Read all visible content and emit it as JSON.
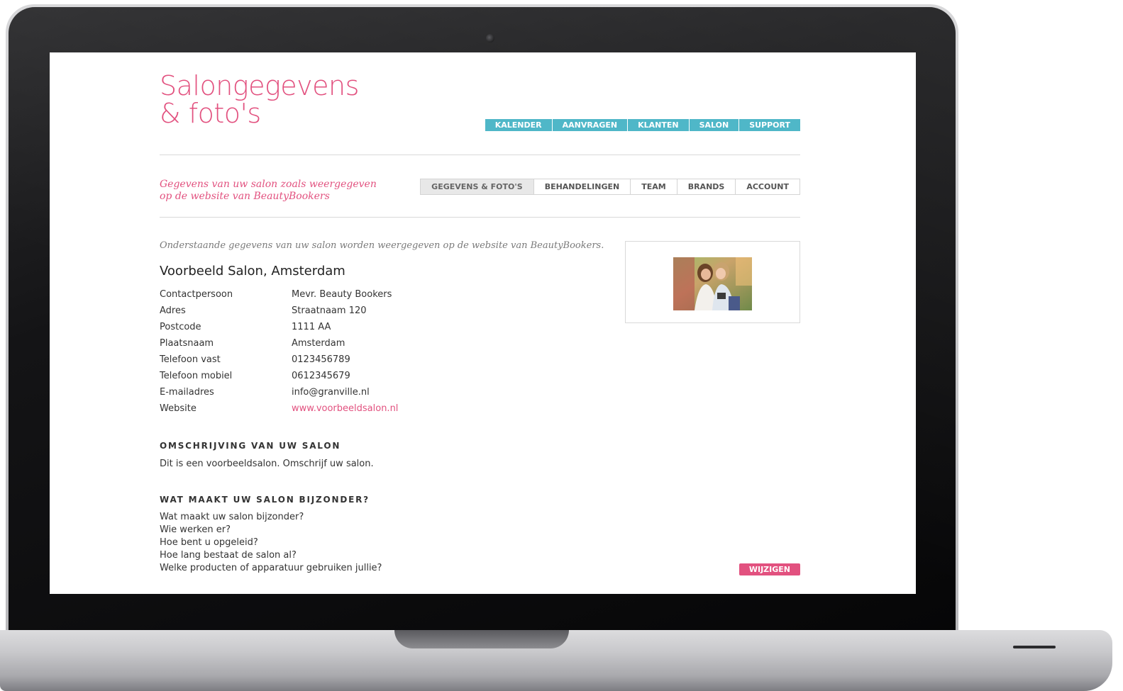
{
  "page": {
    "title_line1": "Salongegevens",
    "title_line2": "& foto's",
    "subtitle_line1": "Gegevens van uw salon zoals weergegeven",
    "subtitle_line2": "op de website van BeautyBookers"
  },
  "top_nav": [
    "KALENDER",
    "AANVRAGEN",
    "KLANTEN",
    "SALON",
    "SUPPORT"
  ],
  "sub_tabs": {
    "active": "GEGEVENS & FOTO'S",
    "items": [
      "GEGEVENS & FOTO'S",
      "BEHANDELINGEN",
      "TEAM",
      "BRANDS",
      "ACCOUNT"
    ]
  },
  "intro": "Onderstaande gegevens van uw salon worden weergegeven op de website van BeautyBookers.",
  "salon_name": "Voorbeeld Salon, Amsterdam",
  "details": [
    {
      "label": "Contactpersoon",
      "value": "Mevr. Beauty Bookers"
    },
    {
      "label": "Adres",
      "value": "Straatnaam 120"
    },
    {
      "label": "Postcode",
      "value": "1111 AA"
    },
    {
      "label": "Plaatsnaam",
      "value": "Amsterdam"
    },
    {
      "label": "Telefoon vast",
      "value": "0123456789"
    },
    {
      "label": "Telefoon mobiel",
      "value": "0612345679"
    },
    {
      "label": "E-mailadres",
      "value": "info@granville.nl"
    },
    {
      "label": "Website",
      "value": "www.voorbeeldsalon.nl"
    }
  ],
  "description": {
    "heading": "OMSCHRIJVING VAN UW SALON",
    "text": "Dit is een voorbeeldsalon. Omschrijf uw salon."
  },
  "special": {
    "heading": "WAT MAAKT UW SALON BIJZONDER?",
    "lines": [
      "Wat maakt uw salon bijzonder?",
      "Wie werken er?",
      "Hoe bent u opgeleid?",
      "Hoe lang bestaat de salon al?",
      "Welke producten of apparatuur gebruiken jullie?"
    ]
  },
  "buttons": {
    "edit": "WIJZIGEN"
  },
  "colors": {
    "accent_pink": "#e2517f",
    "nav_teal": "#4fb7c8"
  },
  "icons": {
    "photo": "salon-photo-thumbnail"
  }
}
